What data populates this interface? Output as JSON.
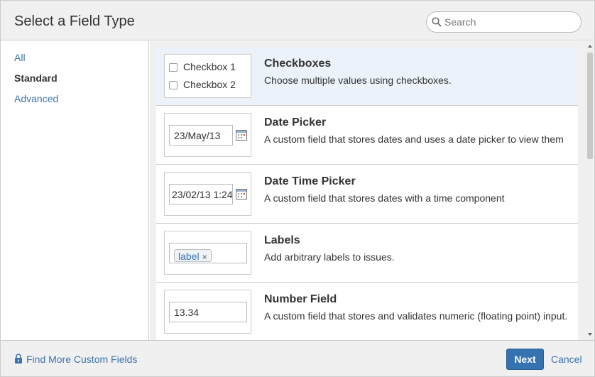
{
  "header": {
    "title": "Select a Field Type",
    "search": {
      "placeholder": "Search",
      "value": ""
    }
  },
  "sidebar": {
    "items": [
      {
        "label": "All",
        "active": false
      },
      {
        "label": "Standard",
        "active": true
      },
      {
        "label": "Advanced",
        "active": false
      }
    ]
  },
  "fields": [
    {
      "name": "Checkboxes",
      "description": "Choose multiple values using checkboxes.",
      "preview": {
        "options": [
          "Checkbox 1",
          "Checkbox 2"
        ]
      },
      "selected": true
    },
    {
      "name": "Date Picker",
      "description": "A custom field that stores dates and uses a date picker to view them",
      "preview": {
        "value": "23/May/13",
        "icon": "calendar-icon"
      }
    },
    {
      "name": "Date Time Picker",
      "description": "A custom field that stores dates with a time component",
      "preview": {
        "value": "23/02/13 1:24",
        "icon": "calendar-icon"
      }
    },
    {
      "name": "Labels",
      "description": "Add arbitrary labels to issues.",
      "preview": {
        "tag": "label",
        "remove": "×"
      }
    },
    {
      "name": "Number Field",
      "description": "A custom field that stores and validates numeric (floating point) input.",
      "preview": {
        "value": "13.34"
      }
    }
  ],
  "footer": {
    "find_more_label": "Find More Custom Fields",
    "find_more_icon": "lock-icon",
    "next_label": "Next",
    "cancel_label": "Cancel"
  },
  "colors": {
    "link": "#3b73af",
    "primary_button": "#3572b0",
    "selected_row": "#ebf2f9",
    "panel_background": "#f0f0f0"
  }
}
